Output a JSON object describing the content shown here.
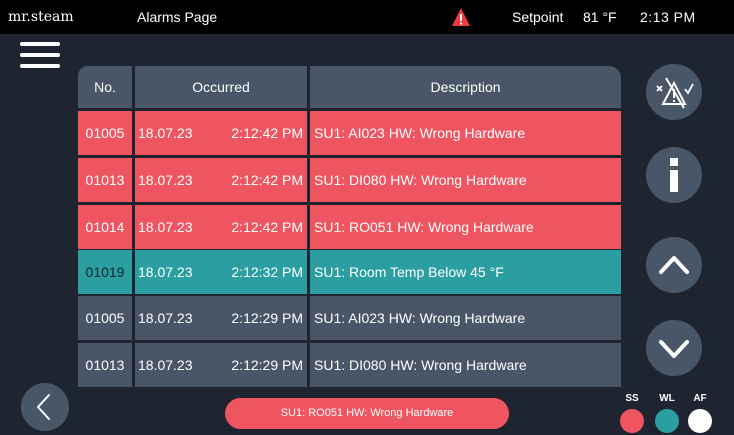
{
  "header": {
    "brand": "mr.steam",
    "page_title": "Alarms Page",
    "setpoint_label": "Setpoint",
    "setpoint_value": "81 °F",
    "time": "2:13 PM"
  },
  "table": {
    "headers": {
      "no": "No.",
      "occurred": "Occurred",
      "description": "Description"
    },
    "rows": [
      {
        "no": "01005",
        "date": "18.07.23",
        "time": "2:12:42 PM",
        "description": "SU1: AI023 HW: Wrong Hardware",
        "status": "active"
      },
      {
        "no": "01013",
        "date": "18.07.23",
        "time": "2:12:42 PM",
        "description": "SU1: DI080 HW: Wrong Hardware",
        "status": "active"
      },
      {
        "no": "01014",
        "date": "18.07.23",
        "time": "2:12:42 PM",
        "description": "SU1: RO051 HW: Wrong Hardware",
        "status": "active"
      },
      {
        "no": "01019",
        "date": "18.07.23",
        "time": "2:12:32 PM",
        "description": "SU1: Room Temp Below  45 °F",
        "status": "warning"
      },
      {
        "no": "01005",
        "date": "18.07.23",
        "time": "2:12:29 PM",
        "description": "SU1: AI023 HW: Wrong Hardware",
        "status": "cleared"
      },
      {
        "no": "01013",
        "date": "18.07.23",
        "time": "2:12:29 PM",
        "description": "SU1: DI080 HW: Wrong Hardware",
        "status": "cleared"
      }
    ]
  },
  "footer": {
    "current_alarm": "SU1: RO051 HW: Wrong Hardware"
  },
  "indicators": [
    {
      "label": "SS",
      "color": "#ef5560"
    },
    {
      "label": "WL",
      "color": "#2a9ea0"
    },
    {
      "label": "AF",
      "color": "#ffffff"
    }
  ],
  "colors": {
    "active": "#ef5560",
    "warning": "#2a9ea0",
    "cleared": "#495668",
    "background": "#1f2530"
  },
  "icons": {
    "warning": "warning-triangle-icon",
    "menu": "hamburger-menu-icon",
    "reset": "alarm-reset-icon",
    "info": "info-icon",
    "up": "chevron-up-icon",
    "down": "chevron-down-icon",
    "back": "chevron-left-icon"
  }
}
